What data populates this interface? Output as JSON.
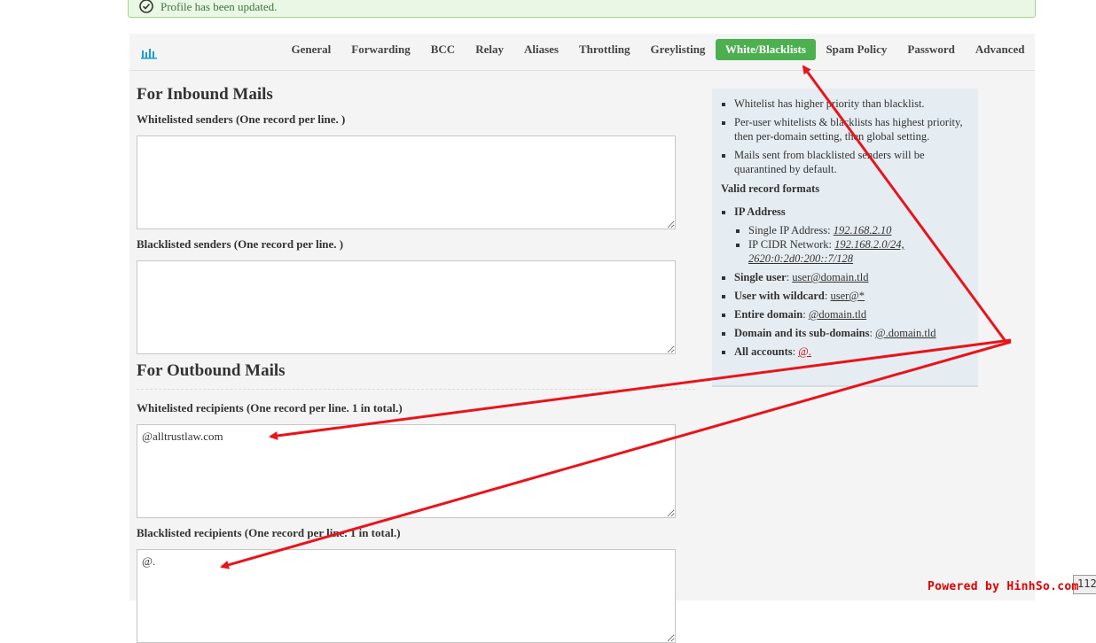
{
  "alert": {
    "message": "Profile has been updated.",
    "icon": "check-circle-icon"
  },
  "tabs": [
    {
      "label": "General",
      "active": false
    },
    {
      "label": "Forwarding",
      "active": false
    },
    {
      "label": "BCC",
      "active": false
    },
    {
      "label": "Relay",
      "active": false
    },
    {
      "label": "Aliases",
      "active": false
    },
    {
      "label": "Throttling",
      "active": false
    },
    {
      "label": "Greylisting",
      "active": false
    },
    {
      "label": "White/Blacklists",
      "active": true
    },
    {
      "label": "Spam Policy",
      "active": false
    },
    {
      "label": "Password",
      "active": false
    },
    {
      "label": "Advanced",
      "active": false
    }
  ],
  "inbound": {
    "heading": "For Inbound Mails",
    "whitelisted_label": "Whitelisted senders (One record per line. )",
    "whitelisted_value": "",
    "blacklisted_label": "Blacklisted senders (One record per line. )",
    "blacklisted_value": ""
  },
  "outbound": {
    "heading": "For Outbound Mails",
    "whitelisted_label": "Whitelisted recipients (One record per line. 1 in total.)",
    "whitelisted_value": "@alltrustlaw.com",
    "blacklisted_label": "Blacklisted recipients (One record per line. 1 in total.)",
    "blacklisted_value": "@."
  },
  "info": {
    "notes": [
      "Whitelist has higher priority than blacklist.",
      "Per-user whitelists & blacklists has highest priority, then per-domain setting, then global setting.",
      "Mails sent from blacklisted senders will be quarantined by default."
    ],
    "formats_title": "Valid record formats",
    "ip_address": {
      "label": "IP Address",
      "single_label": "Single IP Address:",
      "single_example": "192.168.2.10",
      "cidr_label": "IP CIDR Network:",
      "cidr_example": "192.168.2.0/24, 2620:0:2d0:200::7/128"
    },
    "formats": [
      {
        "label": "Single user",
        "example": "user@domain.tld"
      },
      {
        "label": "User with wildcard",
        "example": "user@*"
      },
      {
        "label": "Entire domain",
        "example": "@domain.tld"
      },
      {
        "label": "Domain and its sub-domains",
        "example": "@.domain.tld"
      },
      {
        "label": "All accounts",
        "example": "@."
      }
    ]
  },
  "overlay": {
    "zoom_text": "112",
    "watermark": "Powered by HinhSo.com",
    "arrow_color": "#e8141b"
  },
  "colors": {
    "active_tab": "#4caf50",
    "alert_bg": "#e9f7e4",
    "info_bg": "#e6edf2",
    "panel_bg": "#f4f4f4"
  }
}
